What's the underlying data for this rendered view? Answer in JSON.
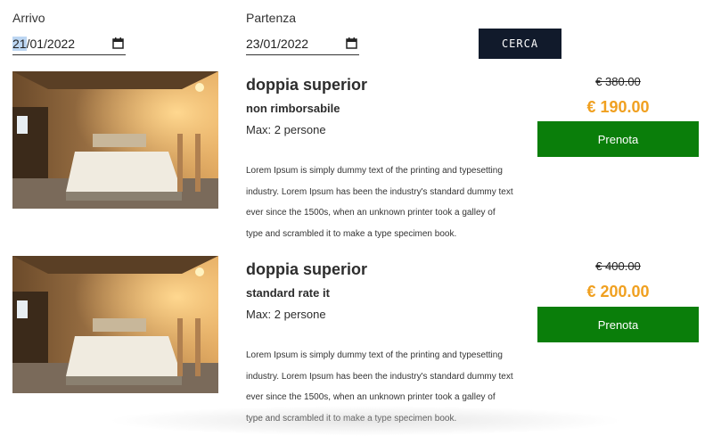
{
  "search": {
    "arrival_label": "Arrivo",
    "arrival_day": "21",
    "arrival_rest": "/01/2022",
    "departure_label": "Partenza",
    "departure_value": "23/01/2022",
    "search_button": "CERCA"
  },
  "colors": {
    "search_button_bg": "#111a2b",
    "price_accent": "#f0a020",
    "book_button_bg": "#0a7e0a"
  },
  "rooms": [
    {
      "title": "doppia superior",
      "rate": "non rimborsabile",
      "max": "Max: 2 persone",
      "description": "Lorem Ipsum is simply dummy text of the printing and typesetting industry. Lorem Ipsum has been the industry's standard dummy text ever since the 1500s, when an unknown printer took a galley of type and scrambled it to make a type specimen book.",
      "old_price": "€ 380.00",
      "price": "€ 190.00",
      "book_label": "Prenota"
    },
    {
      "title": "doppia superior",
      "rate": "standard rate it",
      "max": "Max: 2 persone",
      "description": "Lorem Ipsum is simply dummy text of the printing and typesetting industry. Lorem Ipsum has been the industry's standard dummy text ever since the 1500s, when an unknown printer took a galley of type and scrambled it to make a type specimen book.",
      "old_price": "€ 400.00",
      "price": "€ 200.00",
      "book_label": "Prenota"
    }
  ]
}
